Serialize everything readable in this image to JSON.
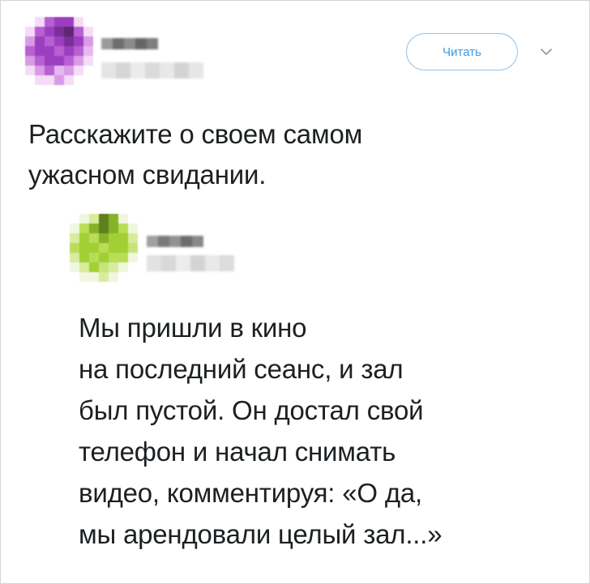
{
  "tweet": {
    "follow_label": "Читать",
    "text_lines": [
      "Расскажите о своем самом",
      "ужасном свидании."
    ],
    "icons": {
      "avatar": "blurred-avatar-purple",
      "chevron": "chevron-down-icon"
    },
    "colors": {
      "accent": "#3d9ae0",
      "avatar_main": "#a24fc8"
    }
  },
  "reply": {
    "text_lines": [
      "Мы пришли в кино",
      "на последний сеанс, и зал",
      "был пустой. Он достал свой",
      "телефон и начал снимать",
      "видео, комментируя: «О да,",
      "мы арендовали целый зал...»"
    ],
    "icons": {
      "avatar": "blurred-avatar-green"
    },
    "colors": {
      "avatar_main": "#a8d237"
    }
  }
}
